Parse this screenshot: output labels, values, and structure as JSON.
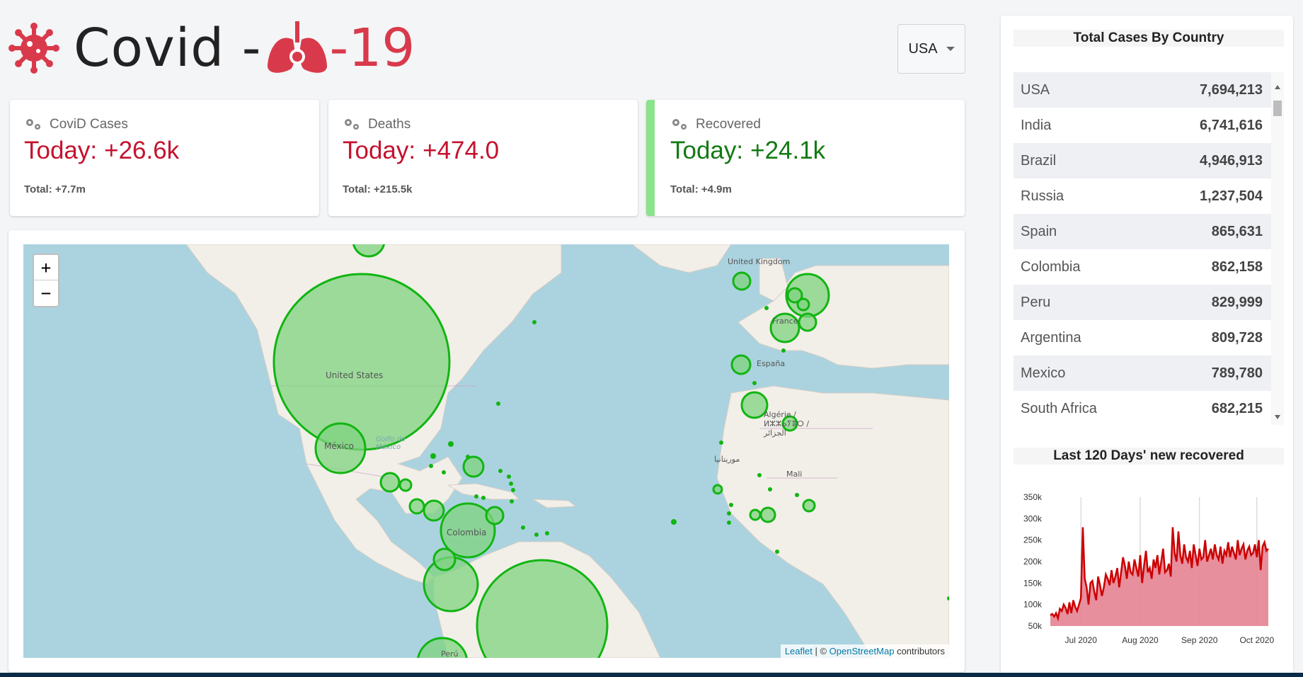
{
  "header": {
    "title": "Covid -",
    "title_num": "-19",
    "accent_color": "#d93a4b"
  },
  "country_select": {
    "selected": "USA"
  },
  "cards": [
    {
      "label": "CoviD Cases",
      "today_label": "Today:",
      "today_value": "+26.6k",
      "total": "Total: +7.7m",
      "color": "#c4122f"
    },
    {
      "label": "Deaths",
      "today_label": "Today:",
      "today_value": "+474.0",
      "total": "Total: +215.5k",
      "color": "#c4122f"
    },
    {
      "label": "Recovered",
      "today_label": "Today:",
      "today_value": "+24.1k",
      "total": "Total: +4.9m",
      "color": "#137a13"
    }
  ],
  "map": {
    "zoom_in": "+",
    "zoom_out": "−",
    "labels": {
      "us": "United States",
      "mx": "México",
      "golfo": "Golfo de México",
      "co": "Colombia",
      "uk": "United Kingdom",
      "fr": "France",
      "es": "España",
      "dz": "Algérie / ⵍⵣⵣⴰⵢⴻⵔ / الجزائر",
      "mr": "موريتانيا",
      "ml": "Mali",
      "pe": "Perú"
    },
    "attribution": {
      "leaflet": "Leaflet",
      "sep": " | © ",
      "osm": "OpenStreetMap",
      "suffix": " contributors"
    }
  },
  "sidebar": {
    "table_title": "Total Cases By Country",
    "countries": [
      {
        "name": "USA",
        "count": "7,694,213"
      },
      {
        "name": "India",
        "count": "6,741,616"
      },
      {
        "name": "Brazil",
        "count": "4,946,913"
      },
      {
        "name": "Russia",
        "count": "1,237,504"
      },
      {
        "name": "Spain",
        "count": "865,631"
      },
      {
        "name": "Colombia",
        "count": "862,158"
      },
      {
        "name": "Peru",
        "count": "829,999"
      },
      {
        "name": "Argentina",
        "count": "809,728"
      },
      {
        "name": "Mexico",
        "count": "789,780"
      },
      {
        "name": "South Africa",
        "count": "682,215"
      }
    ],
    "chart_title": "Last 120 Days' new recovered"
  },
  "chart_data": {
    "type": "area",
    "title": "Last 120 Days' new recovered",
    "line_color": "#cc0000",
    "fill_color": "#e58394",
    "ylim": [
      50000,
      350000
    ],
    "y_ticks": [
      "350k",
      "300k",
      "250k",
      "200k",
      "150k",
      "100k",
      "50k"
    ],
    "x_ticks": [
      "Jul 2020",
      "Aug 2020",
      "Sep 2020",
      "Oct 2020"
    ],
    "x_tick_days": [
      16,
      47,
      78,
      108
    ],
    "series": [
      {
        "values": [
          75000,
          78000,
          72000,
          80000,
          68000,
          90000,
          85000,
          100000,
          92000,
          78000,
          105000,
          80000,
          110000,
          95000,
          85000,
          100000,
          115000,
          280000,
          160000,
          140000,
          100000,
          150000,
          155000,
          130000,
          110000,
          165000,
          145000,
          120000,
          140000,
          170000,
          160000,
          145000,
          180000,
          150000,
          165000,
          185000,
          140000,
          175000,
          210000,
          190000,
          160000,
          200000,
          175000,
          170000,
          205000,
          185000,
          165000,
          215000,
          150000,
          190000,
          225000,
          175000,
          185000,
          160000,
          205000,
          185000,
          215000,
          170000,
          200000,
          230000,
          175000,
          180000,
          195000,
          165000,
          280000,
          220000,
          200000,
          270000,
          215000,
          195000,
          240000,
          210000,
          200000,
          225000,
          185000,
          240000,
          215000,
          190000,
          230000,
          205000,
          210000,
          250000,
          200000,
          215000,
          230000,
          205000,
          240000,
          215000,
          205000,
          235000,
          195000,
          225000,
          215000,
          245000,
          210000,
          235000,
          220000,
          205000,
          250000,
          215000,
          230000,
          240000,
          205000,
          225000,
          235000,
          215000,
          220000,
          240000,
          210000,
          250000,
          180000,
          235000,
          245000,
          225000,
          230000
        ]
      }
    ]
  }
}
